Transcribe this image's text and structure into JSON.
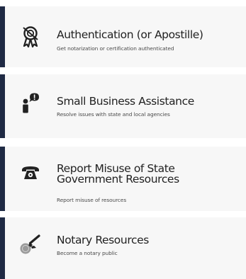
{
  "cards": [
    {
      "title": "Authentication (or Apostille)",
      "subtitle": "Get notarization or certification authenticated",
      "icon": "award-ribbon-icon"
    },
    {
      "title": "Small Business Assistance",
      "subtitle": "Resolve issues with state and local agencies",
      "icon": "person-speech-icon"
    },
    {
      "title": "Report Misuse of State Government Resources",
      "subtitle": "Report misuse of resources",
      "icon": "telephone-icon"
    },
    {
      "title": "Notary Resources",
      "subtitle": "Become a notary public",
      "icon": "notary-stamp-icon"
    }
  ],
  "colors": {
    "accent_bar": "#1f2a44",
    "card_background": "#f7f7f7",
    "icon": "#222222",
    "stamp_seal": "#9a9a9a"
  }
}
